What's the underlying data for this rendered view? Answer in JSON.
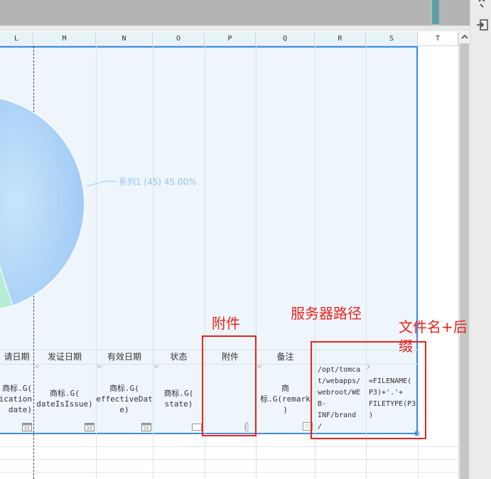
{
  "columns": [
    "L",
    "M",
    "N",
    "O",
    "P",
    "Q",
    "R",
    "S",
    "T"
  ],
  "chart_data": {
    "type": "pie",
    "slices": [
      {
        "label": "系列1 (45) 45.00%",
        "name": "系列1",
        "value": 45,
        "percent": 45.0,
        "color": "#a9cdf6"
      }
    ],
    "label_color": "#94c3ee"
  },
  "header_row": [
    "请日期",
    "发证日期",
    "有效日期",
    "状态",
    "附件",
    "备注"
  ],
  "value_row": {
    "l": [
      "商标.G(",
      "lication",
      "date)"
    ],
    "m": [
      "商标.G(",
      "dateIsIssue)"
    ],
    "n": [
      "商标.G(",
      "effectiveDat",
      "e)"
    ],
    "o": [
      "商标.G(",
      "state)"
    ],
    "p": "",
    "q": [
      "商标.G(remark",
      ")"
    ],
    "r": [
      "/opt/tomca",
      "t/webapps/",
      "webroot/WE",
      "B-INF/brand",
      "/"
    ],
    "s": [
      "=FILENAME(",
      "P3)+'.'+",
      "FILETYPE(P3",
      ")"
    ]
  },
  "annotations": {
    "attachment": "附件",
    "server_path": "服务器路径",
    "filename_line1": "文件名+后",
    "filename_line2": "缀"
  },
  "colors": {
    "accent": "#3f8de3",
    "annotation_red": "#e8241b"
  }
}
